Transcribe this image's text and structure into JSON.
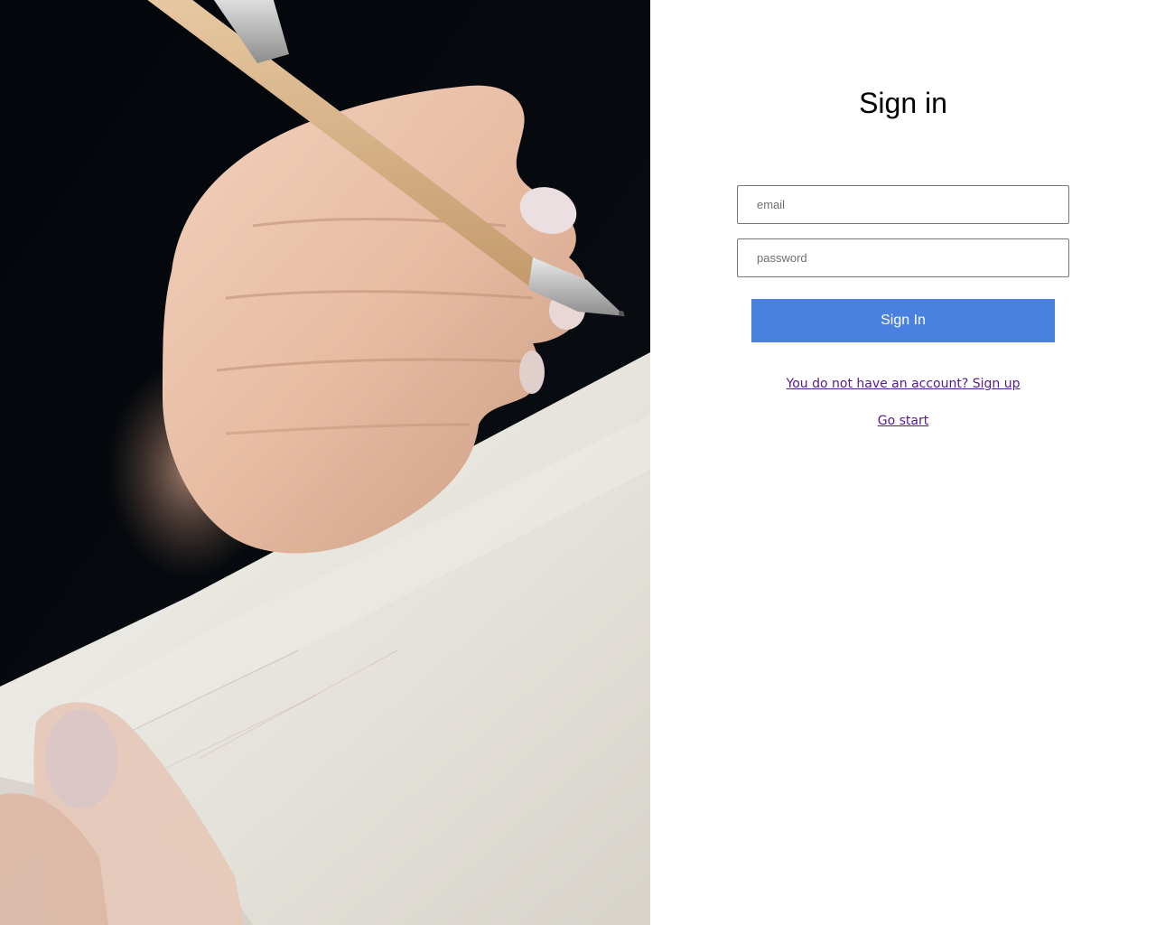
{
  "hero_image": {
    "name": "hand-writing-with-pencil-photo"
  },
  "form": {
    "title": "Sign in",
    "email_placeholder": "email",
    "password_placeholder": "password",
    "submit_label": "Sign In",
    "signup_link": "You do not have an account? Sign up",
    "go_start_link": "Go start"
  },
  "colors": {
    "button_bg": "#4a80e0",
    "link": "#551a8b"
  }
}
